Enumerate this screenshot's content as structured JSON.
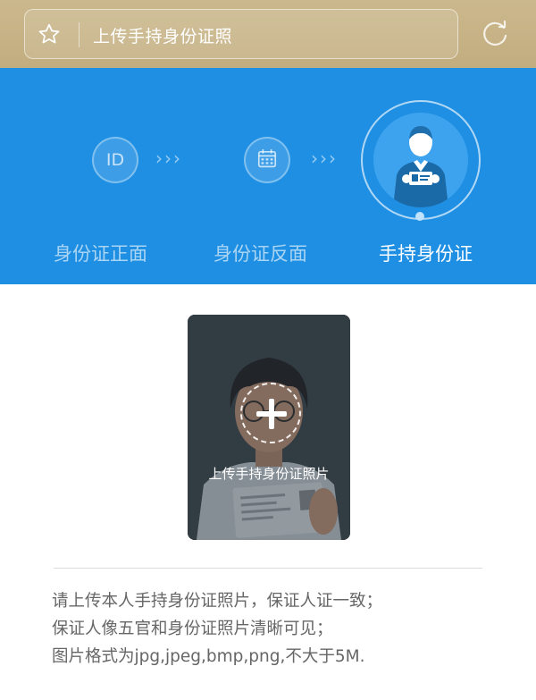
{
  "header": {
    "title": "上传手持身份证照",
    "icons": {
      "favorite": "star-icon",
      "refresh": "refresh-icon"
    },
    "background_color": "#c8b486"
  },
  "steps": {
    "accent_color": "#1e8fe3",
    "items": [
      {
        "label": "身份证正面",
        "icon_text": "ID",
        "active": false
      },
      {
        "label": "身份证反面",
        "icon": "calendar-icon",
        "active": false
      },
      {
        "label": "手持身份证",
        "icon": "person-holding-id-icon",
        "active": true
      }
    ],
    "separator": "›››"
  },
  "upload": {
    "label": "上传手持身份证照片",
    "icon": "plus-icon"
  },
  "instructions": [
    "请上传本人手持身份证照片，保证人证一致；",
    "保证人像五官和身份证照片清晰可见；",
    "图片格式为jpg,jpeg,bmp,png,不大于5M."
  ]
}
